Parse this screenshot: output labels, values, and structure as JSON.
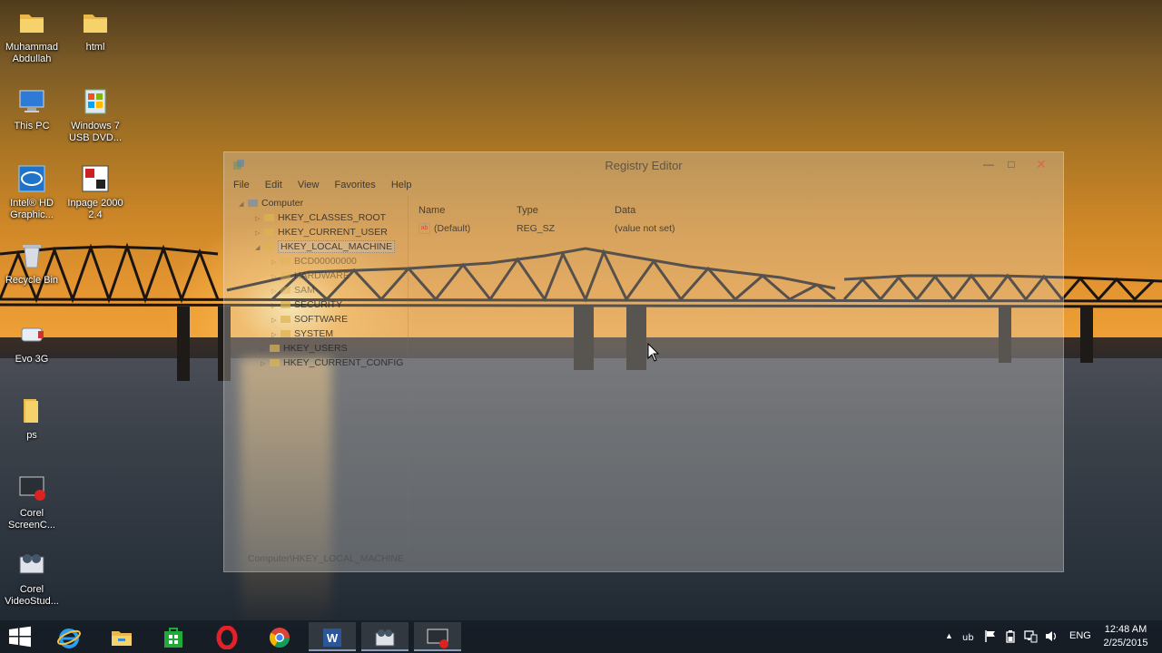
{
  "desktop": {
    "icons": [
      {
        "label": "Muhammad Abdullah",
        "icon": "folder-user-icon"
      },
      {
        "label": "html",
        "icon": "folder-icon"
      },
      {
        "label": "This PC",
        "icon": "computer-icon"
      },
      {
        "label": "Windows 7 USB DVD...",
        "icon": "usb-dvd-tool-icon"
      },
      {
        "label": "Intel® HD Graphic...",
        "icon": "intel-graphics-icon"
      },
      {
        "label": "Inpage 2000 2.4",
        "icon": "inpage-icon"
      },
      {
        "label": "Recycle Bin",
        "icon": "recycle-bin-icon"
      },
      {
        "label": "Evo 3G",
        "icon": "evo-3g-icon"
      },
      {
        "label": "ps",
        "icon": "folder-icon"
      },
      {
        "label": "Corel ScreenC...",
        "icon": "corel-screencap-icon"
      },
      {
        "label": "Corel VideoStud...",
        "icon": "corel-videostudio-icon"
      }
    ]
  },
  "regedit": {
    "title": "Registry Editor",
    "menu": [
      "File",
      "Edit",
      "View",
      "Favorites",
      "Help"
    ],
    "tree": {
      "root": "Computer",
      "hkey_classes_root": "HKEY_CLASSES_ROOT",
      "hkey_current_user": "HKEY_CURRENT_USER",
      "hkey_local_machine": "HKEY_LOCAL_MACHINE",
      "bcd": "BCD00000000",
      "hardware": "HARDWARE",
      "sam": "SAM",
      "security": "SECURITY",
      "software": "SOFTWARE",
      "system": "SYSTEM",
      "hkey_users": "HKEY_USERS",
      "hkey_current_config": "HKEY_CURRENT_CONFIG"
    },
    "columns": {
      "name": "Name",
      "type": "Type",
      "data": "Data"
    },
    "rows": [
      {
        "name": "(Default)",
        "type": "REG_SZ",
        "data": "(value not set)"
      }
    ],
    "status": "Computer\\HKEY_LOCAL_MACHINE"
  },
  "taskbar": {
    "apps": [
      "internet-explorer-icon",
      "file-explorer-icon",
      "store-icon",
      "opera-icon",
      "chrome-icon",
      "word-icon",
      "corel-videostudio-icon",
      "screen-recorder-icon"
    ],
    "language": "ENG",
    "time": "12:48 AM",
    "date": "2/25/2015"
  },
  "colors": {
    "accent": "#1f73c9",
    "taskbar": "#161c24",
    "close": "#e65a46"
  }
}
